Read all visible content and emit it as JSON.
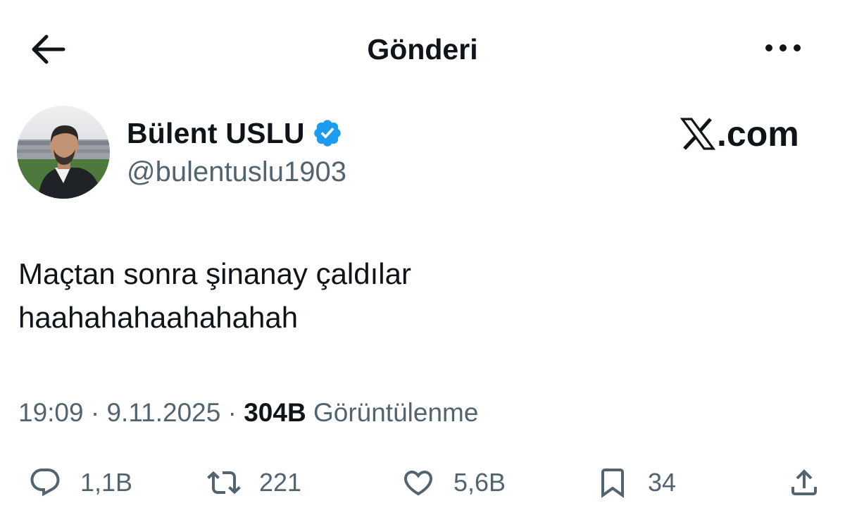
{
  "header": {
    "title": "Gönderi",
    "back_icon": "arrow-left-icon",
    "more_icon": "more-horizontal-icon"
  },
  "author": {
    "name": "Bülent USLU",
    "handle": "@bulentuslu1903",
    "verified": true,
    "verified_color": "#1d9bf0",
    "avatar_icon": "profile-photo"
  },
  "watermark": {
    "text": ".com",
    "logo_icon": "x-logo-icon"
  },
  "tweet": {
    "lines": [
      "Maçtan sonra şinanay çaldılar",
      "haahahahaahahahah"
    ]
  },
  "meta": {
    "time": "19:09",
    "sep1": " · ",
    "date": "9.11.2025",
    "sep2": " · ",
    "views": "304B",
    "views_label": " Görüntülenme"
  },
  "actions": {
    "reply": {
      "icon": "reply-icon",
      "count": "1,1B"
    },
    "retweet": {
      "icon": "retweet-icon",
      "count": "221"
    },
    "like": {
      "icon": "heart-icon",
      "count": "5,6B"
    },
    "bookmark": {
      "icon": "bookmark-icon",
      "count": "34"
    },
    "share": {
      "icon": "share-icon"
    }
  },
  "colors": {
    "text": "#0f1419",
    "secondary": "#536471",
    "accent": "#1d9bf0",
    "background": "#ffffff"
  }
}
